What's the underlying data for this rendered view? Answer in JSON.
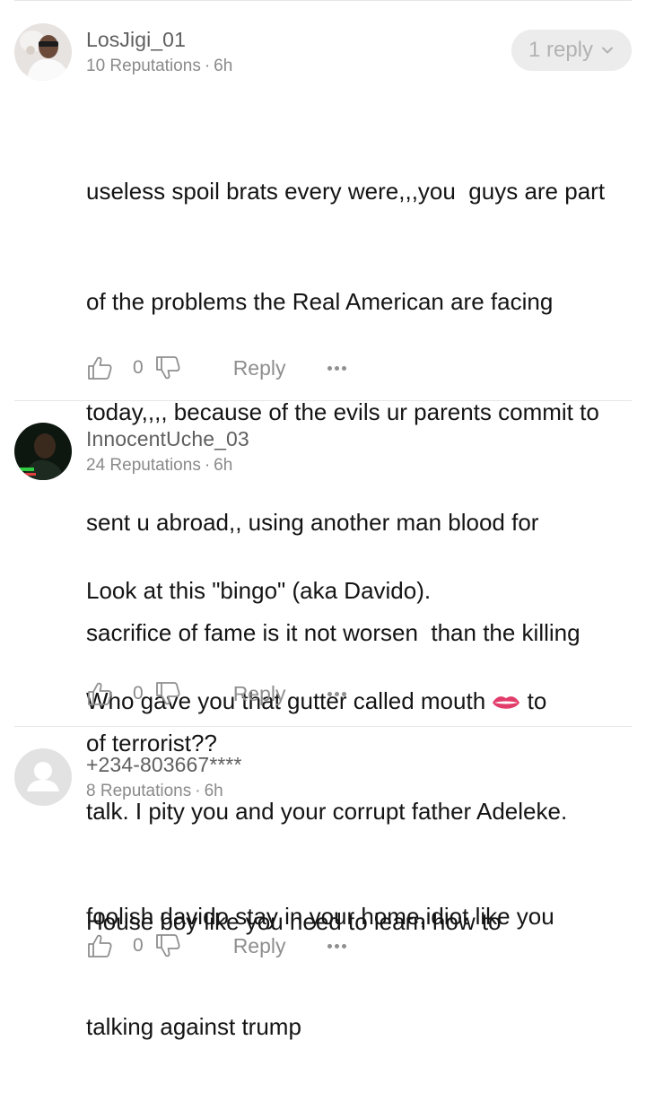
{
  "comments": [
    {
      "username": "LosJigi_01",
      "reputation": "10 Reputations",
      "time": "6h",
      "reply_pill": "1 reply",
      "text_lines": [
        "useless spoil brats every were,,,you  guys are part",
        "of the problems the Real American are facing",
        "today,,,, because of the evils ur parents commit to",
        "sent u abroad,, using another man blood for",
        "sacrifice of fame is it not worsen  than the killing",
        "of terrorist??"
      ],
      "likes": "0",
      "reply_label": "Reply"
    },
    {
      "username": "InnocentUche_03",
      "reputation": "24 Reputations",
      "time": "6h",
      "text_lines": [
        "Look at this \"bingo\" (aka Davido).",
        "Who gave you that gutter called mouth",
        "to",
        "talk. I pity you and your corrupt father Adeleke.",
        "House boy like you need to learn how to"
      ],
      "likes": "0",
      "reply_label": "Reply"
    },
    {
      "username": "+234-803667****",
      "reputation": "8 Reputations",
      "time": "6h",
      "text_lines": [
        "foolish davido stay in your home,idiot like you",
        "talking against trump"
      ],
      "likes": "0",
      "reply_label": "Reply"
    }
  ],
  "icons": {
    "like": "thumbs-up-outline-icon",
    "dislike": "thumbs-down-outline-icon",
    "more": "more-dots-icon",
    "chevron": "chevron-down-icon",
    "lips": "lips-emoji"
  },
  "colors": {
    "text": "#141414",
    "muted": "#8a8a8a",
    "pill_bg": "#ececec",
    "divider": "#e6e6e6"
  }
}
